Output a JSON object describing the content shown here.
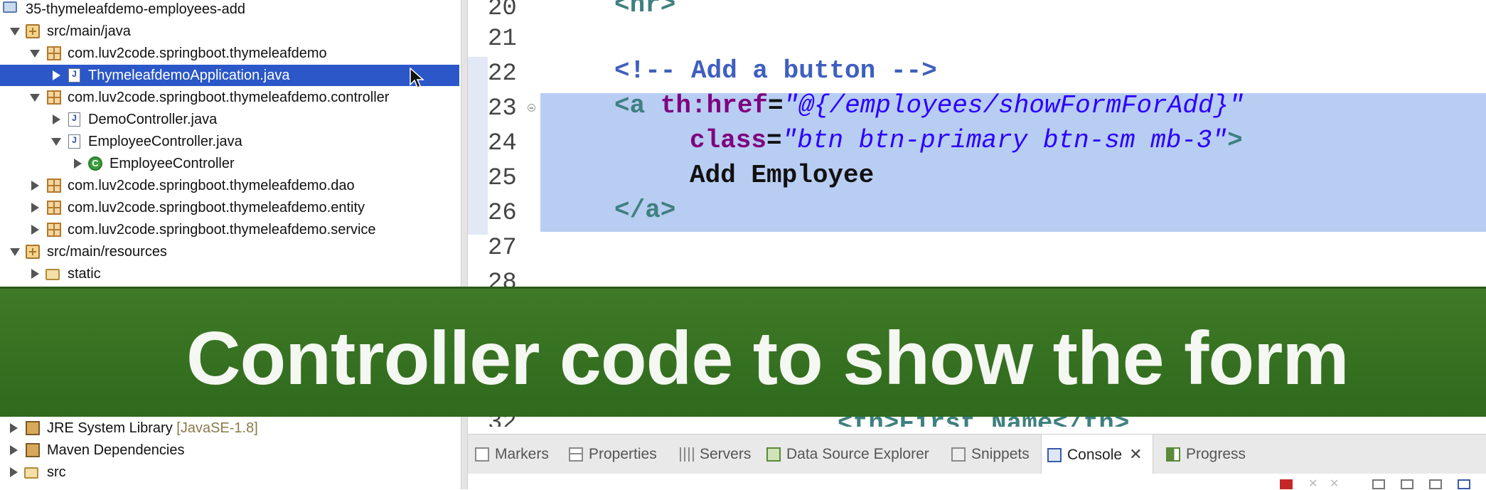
{
  "project_explorer": {
    "rows_top": [
      {
        "label": "35-thymeleafdemo-employees-add",
        "icon": "project-icon"
      },
      {
        "label": "src/main/java",
        "icon": "source-folder-icon"
      },
      {
        "label": "com.luv2code.springboot.thymeleafdemo",
        "icon": "package-icon"
      },
      {
        "label": "ThymeleafdemoApplication.java",
        "icon": "java-file-icon",
        "selected": true
      },
      {
        "label": "com.luv2code.springboot.thymeleafdemo.controller",
        "icon": "package-icon"
      },
      {
        "label": "DemoController.java",
        "icon": "java-file-icon"
      },
      {
        "label": "EmployeeController.java",
        "icon": "java-file-icon"
      },
      {
        "label": "EmployeeController",
        "icon": "class-icon"
      },
      {
        "label": "com.luv2code.springboot.thymeleafdemo.dao",
        "icon": "package-icon"
      },
      {
        "label": "com.luv2code.springboot.thymeleafdemo.entity",
        "icon": "package-icon"
      },
      {
        "label": "com.luv2code.springboot.thymeleafdemo.service",
        "icon": "package-icon"
      },
      {
        "label": "src/main/resources",
        "icon": "source-folder-icon"
      },
      {
        "label": "static",
        "icon": "folder-icon"
      }
    ],
    "rows_bottom": [
      {
        "label": "JRE System Library",
        "suffix": "[JavaSE-1.8]",
        "icon": "library-icon"
      },
      {
        "label": "Maven Dependencies",
        "icon": "library-icon"
      },
      {
        "label": "src",
        "icon": "folder-icon"
      }
    ]
  },
  "editor": {
    "line_numbers": [
      "20",
      "21",
      "22",
      "23",
      "24",
      "25",
      "26",
      "27",
      "28"
    ],
    "line20": "<hr>",
    "line22": "<!-- Add a button -->",
    "line23_tag": "<a ",
    "line23_attr": "th:href",
    "line23_eq": "=",
    "line23_val": "\"@{/employees/showFormForAdd}\"",
    "line24_attr": "class",
    "line24_eq": "=",
    "line24_val": "\"btn btn-primary btn-sm mb-3\"",
    "line24_close": ">",
    "line25": "Add Employee",
    "line26": "</a>",
    "partial_line_number": "32",
    "partial_line_code": "<th>First Name</th>"
  },
  "banner": {
    "text": "Controller code to show the form",
    "color": "#3a7424"
  },
  "bottom_tabs": [
    {
      "label": "Markers",
      "icon": "markers-icon"
    },
    {
      "label": "Properties",
      "icon": "properties-icon"
    },
    {
      "label": "Servers",
      "icon": "servers-icon"
    },
    {
      "label": "Data Source Explorer",
      "icon": "data-source-icon"
    },
    {
      "label": "Snippets",
      "icon": "snippets-icon"
    },
    {
      "label": "Console",
      "icon": "console-icon",
      "active": true
    },
    {
      "label": "Progress",
      "icon": "progress-icon"
    }
  ]
}
